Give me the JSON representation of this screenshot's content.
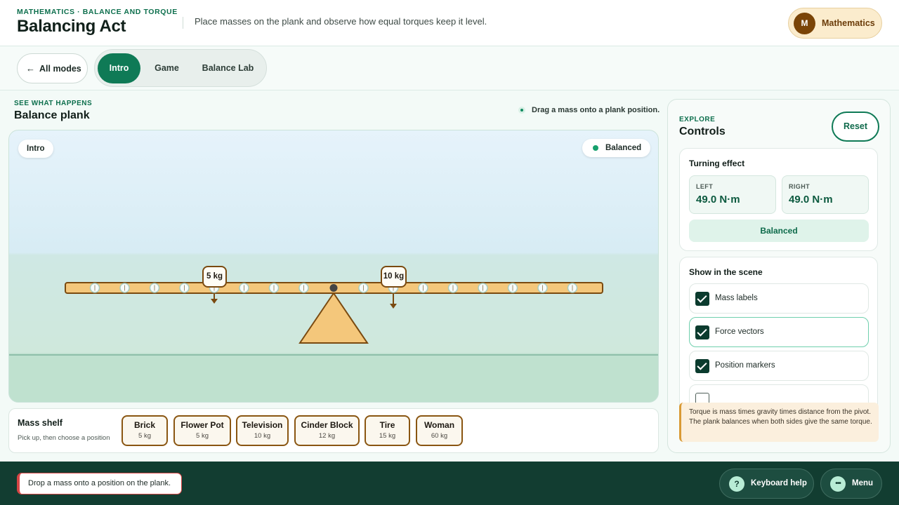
{
  "header": {
    "eyebrow": "MATHEMATICS · BALANCE AND TORQUE",
    "title": "Balancing Act",
    "description": "Place masses on the plank and observe how equal torques keep it level.",
    "subject_initial": "M",
    "subject_label": "Mathematics"
  },
  "modebar": {
    "back_arrow": "←",
    "back_label": "All modes",
    "tabs": [
      {
        "label": "Intro",
        "active": true
      },
      {
        "label": "Game",
        "active": false
      },
      {
        "label": "Balance Lab",
        "active": false
      }
    ]
  },
  "stage": {
    "eyebrow": "SEE WHAT HAPPENS",
    "title": "Balance plank",
    "hint": "Drag a mass onto a plank position.",
    "mode_pill": "Intro",
    "status": "Balanced",
    "placed_masses": [
      {
        "label": "5 kg",
        "position": -4
      },
      {
        "label": "10 kg",
        "position": 2
      }
    ],
    "colors": {
      "plank": "#f4c77b",
      "outline": "#7a4a10",
      "pivot": "#444444"
    }
  },
  "shelf": {
    "title": "Mass shelf",
    "subtitle": "Pick up, then choose a position",
    "items": [
      {
        "name": "Brick",
        "mass": "5 kg"
      },
      {
        "name": "Flower Pot",
        "mass": "5 kg"
      },
      {
        "name": "Television",
        "mass": "10 kg"
      },
      {
        "name": "Cinder Block",
        "mass": "12 kg"
      },
      {
        "name": "Tire",
        "mass": "15 kg"
      },
      {
        "name": "Woman",
        "mass": "60 kg"
      }
    ]
  },
  "controls": {
    "eyebrow": "EXPLORE",
    "title": "Controls",
    "reset_label": "Reset",
    "turning_effect": {
      "title": "Turning effect",
      "left_label": "LEFT",
      "left_value": "49.0 N·m",
      "right_label": "RIGHT",
      "right_value": "49.0 N·m",
      "verdict": "Balanced"
    },
    "show_in_scene": {
      "title": "Show in the scene",
      "options": [
        {
          "label": "Mass labels",
          "checked": true
        },
        {
          "label": "Force vectors",
          "checked": true
        },
        {
          "label": "Position markers",
          "checked": true
        },
        {
          "label": "",
          "checked": false
        }
      ]
    },
    "note": "Torque is mass times gravity times distance from the pivot. The plank balances when both sides give the same torque."
  },
  "footer": {
    "toast": "Drop a mass onto a position on the plank.",
    "keyboard_icon": "?",
    "keyboard_label": "Keyboard help",
    "menu_icon": "•••",
    "menu_label": "Menu"
  }
}
